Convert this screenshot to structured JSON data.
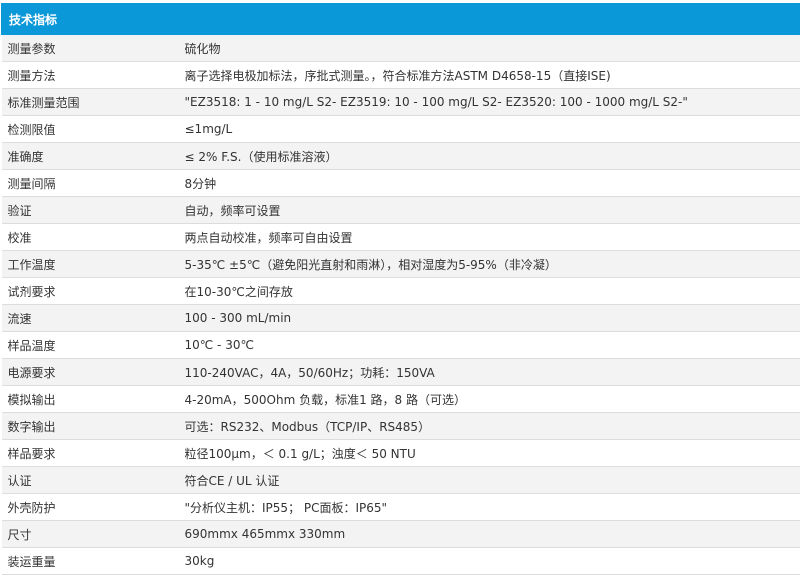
{
  "header": {
    "title": "技术指标"
  },
  "rows": [
    {
      "label": "测量参数",
      "value": "硫化物"
    },
    {
      "label": "测量方法",
      "value": "离子选择电极加标法，序批式测量。，符合标准方法ASTM D4658-15（直接ISE)"
    },
    {
      "label": "标准测量范围",
      "value": "\"EZ3518: 1 - 10 mg/L S2-        EZ3519: 10 - 100 mg/L S2-        EZ3520: 100 - 1000 mg/L S2-\""
    },
    {
      "label": "检测限值",
      "value": "≤1mg/L"
    },
    {
      "label": "准确度",
      "value": "≤ 2% F.S.（使用标准溶液）"
    },
    {
      "label": "测量间隔",
      "value": "8分钟"
    },
    {
      "label": "验证",
      "value": "自动，频率可设置"
    },
    {
      "label": "校准",
      "value": "两点自动校准，频率可自由设置"
    },
    {
      "label": "工作温度",
      "value": "5-35℃ ±5℃（避免阳光直射和雨淋），相对湿度为5-95%（非冷凝）"
    },
    {
      "label": "试剂要求",
      "value": "在10-30℃之间存放"
    },
    {
      "label": "流速",
      "value": "100 - 300 mL/min"
    },
    {
      "label": "样品温度",
      "value": "10℃ - 30℃"
    },
    {
      "label": "电源要求",
      "value": "110-240VAC，4A，50/60Hz；功耗：150VA"
    },
    {
      "label": "模拟输出",
      "value": "4-20mA，500Ohm 负载，标准1 路，8 路（可选）"
    },
    {
      "label": "数字输出",
      "value": "可选：RS232、Modbus（TCP/IP、RS485）"
    },
    {
      "label": "样品要求",
      "value": "粒径100μm，＜ 0.1 g/L；浊度＜ 50 NTU"
    },
    {
      "label": "认证",
      "value": "符合CE / UL 认证"
    },
    {
      "label": "外壳防护",
      "value": "\"分析仪主机：IP55；      PC面板：IP65\""
    },
    {
      "label": "尺寸",
      "value": "690mmx 465mmx 330mm"
    },
    {
      "label": "装运重量",
      "value": "30kg"
    }
  ]
}
